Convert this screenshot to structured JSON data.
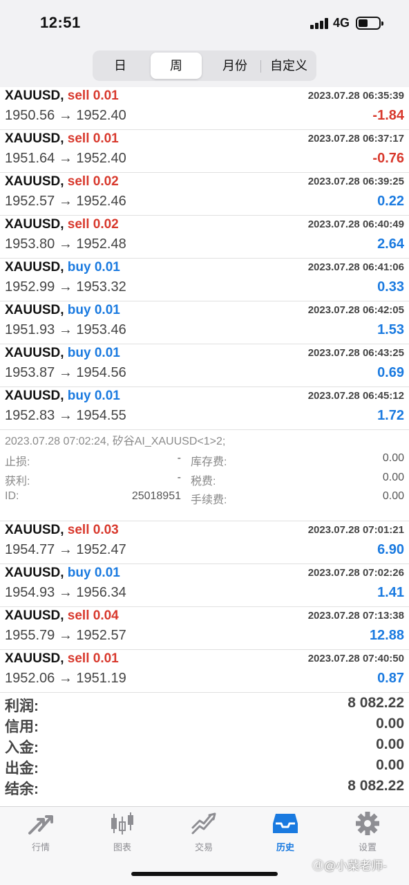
{
  "status": {
    "time": "12:51",
    "network": "4G"
  },
  "period_tabs": [
    {
      "label": "日",
      "active": false
    },
    {
      "label": "周",
      "active": true
    },
    {
      "label": "月份",
      "active": false
    },
    {
      "label": "自定义",
      "active": false
    }
  ],
  "deals_top": [
    {
      "symbol": "XAUUSD,",
      "dir": "sell 0.01",
      "dir_color": "red",
      "time": "2023.07.28 06:35:39",
      "prices": "1950.56 → 1952.40",
      "profit": "-1.84",
      "profit_color": "red"
    },
    {
      "symbol": "XAUUSD,",
      "dir": "sell 0.01",
      "dir_color": "red",
      "time": "2023.07.28 06:37:17",
      "prices": "1951.64 → 1952.40",
      "profit": "-0.76",
      "profit_color": "red"
    },
    {
      "symbol": "XAUUSD,",
      "dir": "sell 0.02",
      "dir_color": "red",
      "time": "2023.07.28 06:39:25",
      "prices": "1952.57 → 1952.46",
      "profit": "0.22",
      "profit_color": "blue"
    },
    {
      "symbol": "XAUUSD,",
      "dir": "sell 0.02",
      "dir_color": "red",
      "time": "2023.07.28 06:40:49",
      "prices": "1953.80 → 1952.48",
      "profit": "2.64",
      "profit_color": "blue"
    },
    {
      "symbol": "XAUUSD,",
      "dir": "buy 0.01",
      "dir_color": "blue",
      "time": "2023.07.28 06:41:06",
      "prices": "1952.99 → 1953.32",
      "profit": "0.33",
      "profit_color": "blue"
    },
    {
      "symbol": "XAUUSD,",
      "dir": "buy 0.01",
      "dir_color": "blue",
      "time": "2023.07.28 06:42:05",
      "prices": "1951.93 → 1953.46",
      "profit": "1.53",
      "profit_color": "blue"
    },
    {
      "symbol": "XAUUSD,",
      "dir": "buy 0.01",
      "dir_color": "blue",
      "time": "2023.07.28 06:43:25",
      "prices": "1953.87 → 1954.56",
      "profit": "0.69",
      "profit_color": "blue"
    },
    {
      "symbol": "XAUUSD,",
      "dir": "buy 0.01",
      "dir_color": "blue",
      "time": "2023.07.28 06:45:12",
      "prices": "1952.83 → 1954.55",
      "profit": "1.72",
      "profit_color": "blue"
    }
  ],
  "detail": {
    "header": "2023.07.28 07:02:24, 矽谷AI_XAUUSD<1>2;",
    "rows": [
      {
        "label1": "止损:",
        "value1": "-",
        "label2": "库存费:",
        "value2": "0.00"
      },
      {
        "label1": "获利:",
        "value1": "-",
        "label2": "税费:",
        "value2": "0.00"
      },
      {
        "label1": "ID:",
        "value1": "25018951",
        "label2": "手续费:",
        "value2": "0.00"
      }
    ]
  },
  "deals_bottom": [
    {
      "symbol": "XAUUSD,",
      "dir": "sell 0.03",
      "dir_color": "red",
      "time": "2023.07.28 07:01:21",
      "prices": "1954.77 → 1952.47",
      "profit": "6.90",
      "profit_color": "blue"
    },
    {
      "symbol": "XAUUSD,",
      "dir": "buy 0.01",
      "dir_color": "blue",
      "time": "2023.07.28 07:02:26",
      "prices": "1954.93 → 1956.34",
      "profit": "1.41",
      "profit_color": "blue"
    },
    {
      "symbol": "XAUUSD,",
      "dir": "sell 0.04",
      "dir_color": "red",
      "time": "2023.07.28 07:13:38",
      "prices": "1955.79 → 1952.57",
      "profit": "12.88",
      "profit_color": "blue"
    },
    {
      "symbol": "XAUUSD,",
      "dir": "sell 0.01",
      "dir_color": "red",
      "time": "2023.07.28 07:40:50",
      "prices": "1952.06 → 1951.19",
      "profit": "0.87",
      "profit_color": "blue"
    }
  ],
  "totals": [
    {
      "label": "利润:",
      "value": "8 082.22"
    },
    {
      "label": "信用:",
      "value": "0.00"
    },
    {
      "label": "入金:",
      "value": "0.00"
    },
    {
      "label": "出金:",
      "value": "0.00"
    },
    {
      "label": "结余:",
      "value": "8 082.22"
    }
  ],
  "tabbar": [
    {
      "label": "行情",
      "icon": "quotes-arrows-icon",
      "active": false
    },
    {
      "label": "图表",
      "icon": "candlestick-chart-icon",
      "active": false
    },
    {
      "label": "交易",
      "icon": "trade-chart-icon",
      "active": false
    },
    {
      "label": "历史",
      "icon": "history-tray-icon",
      "active": true
    },
    {
      "label": "设置",
      "icon": "gear-icon",
      "active": false
    }
  ],
  "watermark": "小菜老师",
  "colors": {
    "red": "#d8382c",
    "blue": "#1a7ae0",
    "inactive": "#8e8e93"
  }
}
